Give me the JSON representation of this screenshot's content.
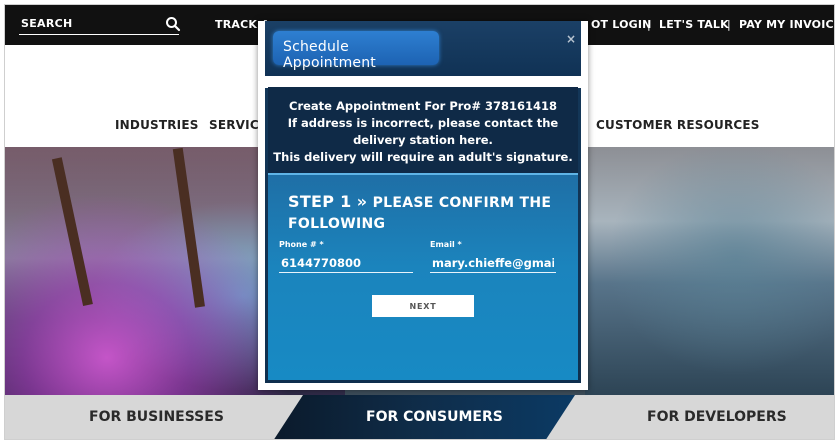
{
  "topbar": {
    "search_label": "SEARCH",
    "items": [
      "TRACK A",
      "OT LOGIN",
      "LET'S TALK",
      "PAY MY INVOICE"
    ],
    "separator": "|"
  },
  "mainnav": {
    "items": [
      "INDUSTRIES",
      "SERVICE",
      "CUSTOMER RESOURCES"
    ]
  },
  "tabs": {
    "businesses": "FOR BUSINESSES",
    "consumers": "FOR CONSUMERS",
    "developers": "FOR DEVELOPERS"
  },
  "modal": {
    "title": "Schedule Appointment",
    "close": "×",
    "info_lines": [
      "Create Appointment For Pro# 378161418",
      "If address is incorrect, please contact the",
      "delivery station here.",
      "This delivery will require an adult's signature."
    ],
    "step_prefix": "STEP 1",
    "step_arrow": "»",
    "step_text_line1": "PLEASE CONFIRM THE",
    "step_text_line2": "FOLLOWING",
    "phone_label": "Phone # *",
    "phone_value": "6144770800",
    "email_label": "Email *",
    "email_value": "mary.chieffe@gmail.c",
    "next_label": "NEXT"
  },
  "colors": {
    "topbar": "#111111",
    "modal_header": "#103255",
    "title_pill": "#1d63b3",
    "info_box": "#0f2a47",
    "form_box": "#1b84bd",
    "active_tab": "#0f2d4a"
  },
  "icons": {
    "search": "search-icon",
    "close": "close-icon"
  }
}
